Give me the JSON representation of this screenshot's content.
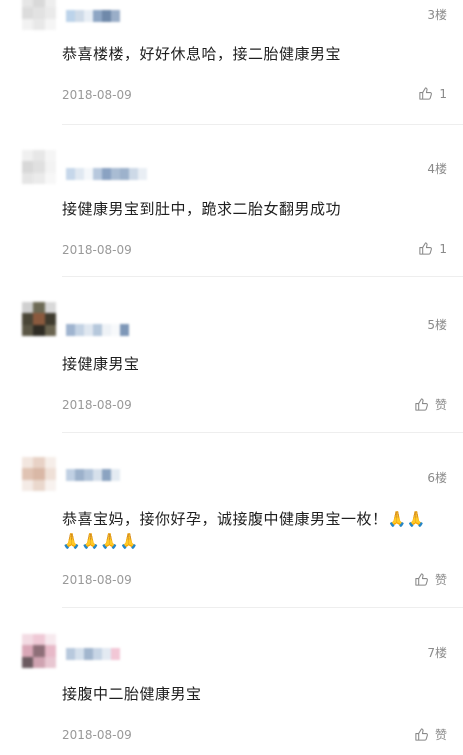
{
  "comments": [
    {
      "floor": "3楼",
      "lines": [
        "恭喜楼楼，好好休息哈，接二胎健康男宝"
      ],
      "date": "2018-08-09",
      "like": "1"
    },
    {
      "floor": "4楼",
      "lines": [
        "接健康男宝到肚中，跪求二胎女翻男成功"
      ],
      "date": "2018-08-09",
      "like": "1"
    },
    {
      "floor": "5楼",
      "lines": [
        "接健康男宝"
      ],
      "date": "2018-08-09",
      "like": "赞"
    },
    {
      "floor": "6楼",
      "lines": [
        "恭喜宝妈，接你好孕，诚接腹中健康男宝一枚！🙏🙏",
        "🙏🙏🙏🙏"
      ],
      "date": "2018-08-09",
      "like": "赞"
    },
    {
      "floor": "7楼",
      "lines": [
        "接腹中二胎健康男宝"
      ],
      "date": "2018-08-09",
      "like": "赞"
    }
  ],
  "colors": {
    "text": "#1f1f1f",
    "meta": "#999999",
    "divider": "#eeeeee"
  }
}
